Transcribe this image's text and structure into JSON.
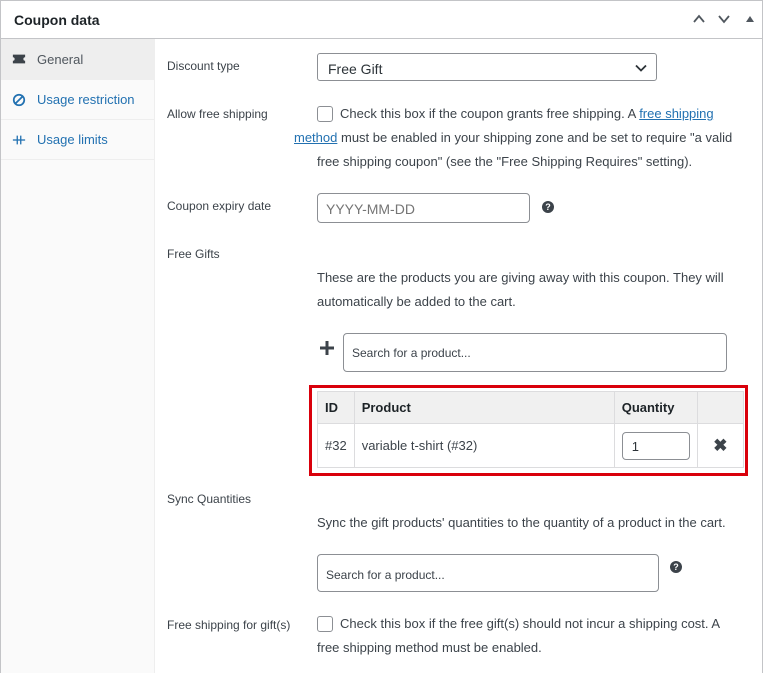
{
  "header": {
    "title": "Coupon data"
  },
  "tabs": [
    {
      "label": "General",
      "icon": "ticket-icon"
    },
    {
      "label": "Usage restriction",
      "icon": "no-entry-icon"
    },
    {
      "label": "Usage limits",
      "icon": "limits-icon"
    }
  ],
  "discount_type": {
    "label": "Discount type",
    "value": "Free Gift"
  },
  "free_shipping": {
    "label": "Allow free shipping",
    "text_before": "Check this box if the coupon grants free shipping. A ",
    "link1": "free shipping",
    "link2": "method",
    "text_after": " must be enabled in your shipping zone and be set to require \"a valid free shipping coupon\" (see the \"Free Shipping Requires\" setting)."
  },
  "expiry": {
    "label": "Coupon expiry date",
    "placeholder": "YYYY-MM-DD"
  },
  "free_gifts": {
    "label": "Free Gifts",
    "description": "These are the products you are giving away with this coupon. They will automatically be added to the cart.",
    "search_placeholder": "Search for a product...",
    "columns": [
      "ID",
      "Product",
      "Quantity"
    ],
    "rows": [
      {
        "id": "#32",
        "product": "variable t-shirt (#32)",
        "quantity": "1"
      }
    ]
  },
  "sync": {
    "label": "Sync Quantities",
    "description": "Sync the gift products' quantities to the quantity of a product in the cart.",
    "search_placeholder": "Search for a product..."
  },
  "gift_shipping": {
    "label": "Free shipping for gift(s)",
    "description": "Check this box if the free gift(s) should not incur a shipping cost. A free shipping method must be enabled."
  },
  "colors": {
    "accent": "#2271b1",
    "highlight": "#d9000b"
  }
}
